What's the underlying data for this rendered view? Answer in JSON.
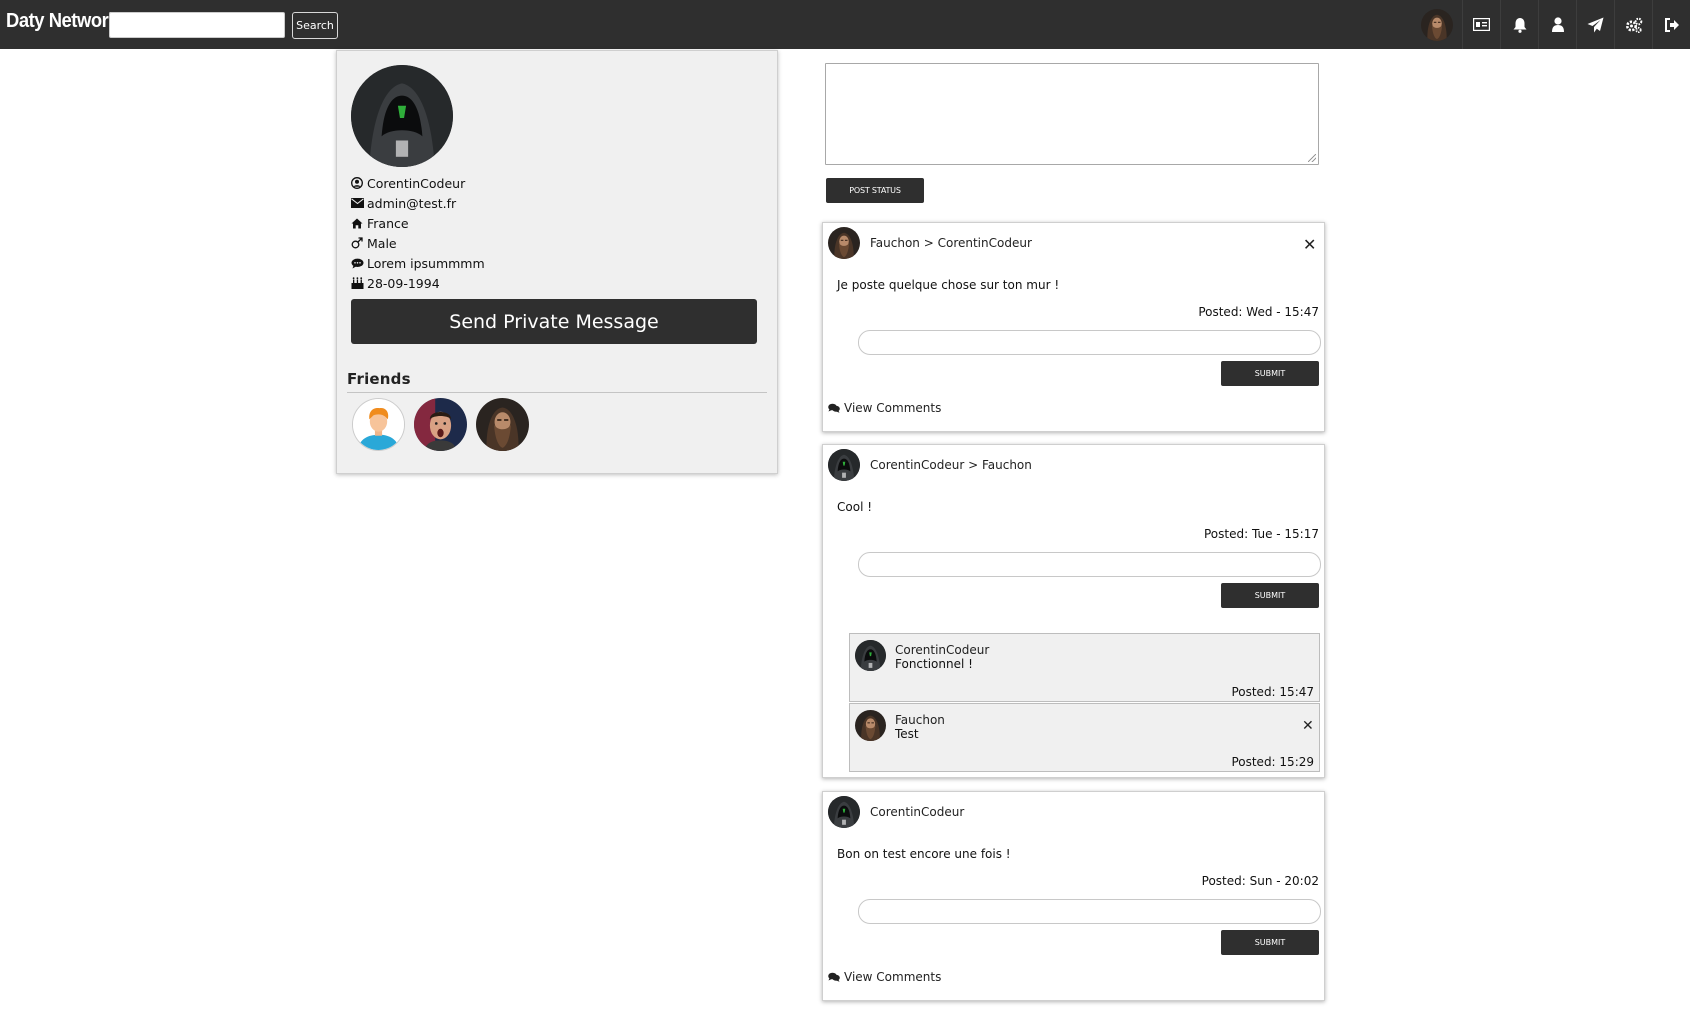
{
  "header": {
    "brand": "Daty Network",
    "search": {
      "value": "",
      "button_label": "Search"
    },
    "icons": [
      "avatar",
      "id-card-icon",
      "bell-icon",
      "user-icon",
      "paper-plane-icon",
      "cogs-icon",
      "sign-out-icon"
    ]
  },
  "profile": {
    "username": "CorentinCodeur",
    "email": "admin@test.fr",
    "country": "France",
    "gender": "Male",
    "bio": "Lorem ipsummmm",
    "birthdate": "28-09-1994",
    "pm_button": "Send Private Message",
    "friends_title": "Friends",
    "friends": [
      "cartoon-boy-avatar",
      "surprised-man-avatar",
      "bearded-man-avatar"
    ]
  },
  "composer": {
    "value": "",
    "button_label": "POST STATUS"
  },
  "posts": [
    {
      "author": "Fauchon > CorentinCodeur",
      "body": "Je poste quelque chose sur ton mur !",
      "date": "Posted: Wed - 15:47",
      "submit_label": "SUBMIT",
      "view_comments": "View Comments"
    },
    {
      "author": "CorentinCodeur > Fauchon",
      "body": "Cool !",
      "date": "Posted: Tue - 15:17",
      "submit_label": "SUBMIT",
      "comments": [
        {
          "author": "CorentinCodeur",
          "text": "Fonctionnel !",
          "date": "Posted: 15:47"
        },
        {
          "author": "Fauchon",
          "text": "Test",
          "date": "Posted: 15:29"
        }
      ]
    },
    {
      "author": "CorentinCodeur",
      "body": "Bon on test encore une fois !",
      "date": "Posted: Sun - 20:02",
      "submit_label": "SUBMIT",
      "view_comments": "View Comments"
    }
  ],
  "close_symbol": "✕"
}
